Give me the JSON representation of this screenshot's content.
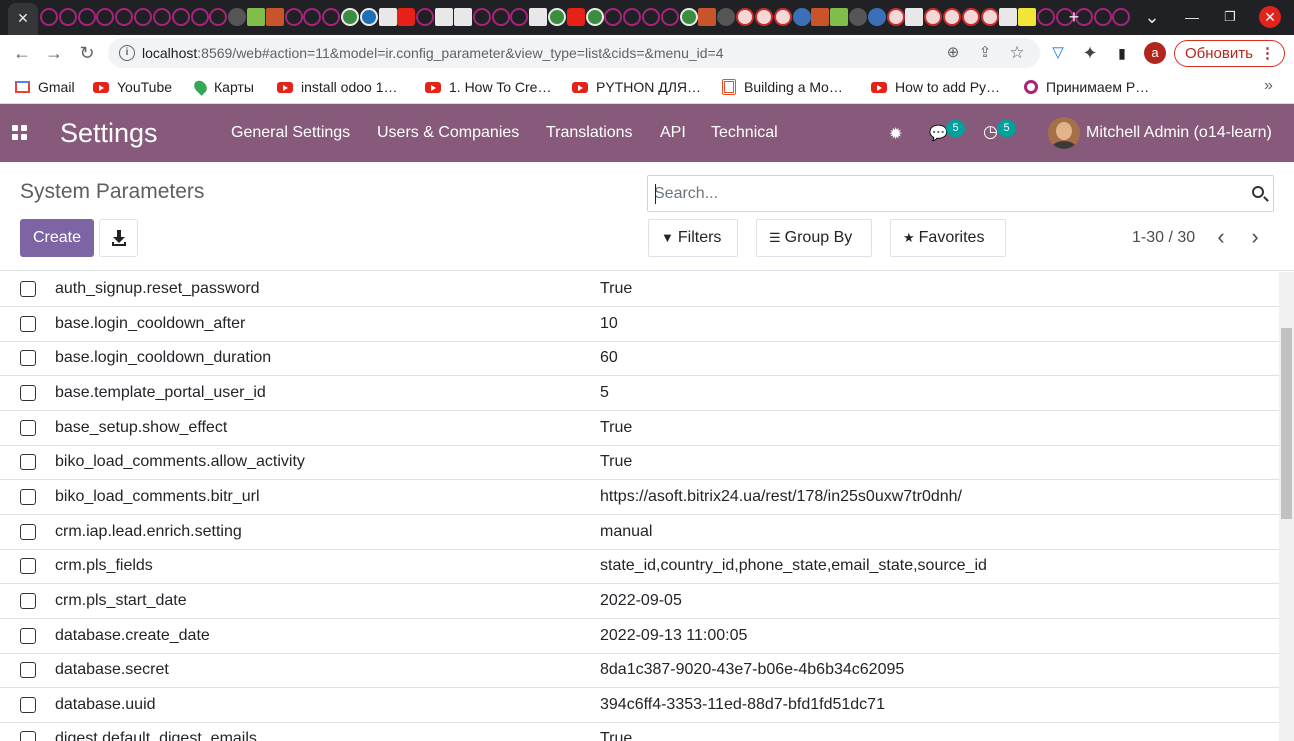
{
  "browser": {
    "tab_close": "✕",
    "new_tab": "+",
    "tab_search": "⌄",
    "min": "—",
    "restore": "❐",
    "close": "✕",
    "url_host": "localhost",
    "url_rest": ":8569/web#action=11&model=ir.config_parameter&view_type=list&cids=&menu_id=4",
    "profile_letter": "a",
    "update_label": "Обновить",
    "update_dots": "⋮",
    "icons": {
      "back": "←",
      "forward": "→",
      "reload": "↻",
      "zoom": "⊕",
      "share": "⇪",
      "star": "☆",
      "vpn": "▽",
      "ext": "✦",
      "sidepanel": "▮"
    }
  },
  "bookmarks": [
    {
      "label": "Gmail",
      "icon": "gmail"
    },
    {
      "label": "YouTube",
      "icon": "youtube"
    },
    {
      "label": "Карты",
      "icon": "maps"
    },
    {
      "label": "install odoo 1…",
      "icon": "youtube"
    },
    {
      "label": "1. How To Cre…",
      "icon": "youtube"
    },
    {
      "label": "PYTHON ДЛЯ…",
      "icon": "youtube"
    },
    {
      "label": "Building a Mo…",
      "icon": "stack"
    },
    {
      "label": "How to add Py…",
      "icon": "youtube"
    },
    {
      "label": "Принимаем Р…",
      "icon": "ring"
    }
  ],
  "bookmarks_more": "»",
  "odoo": {
    "app_title": "Settings",
    "menu": [
      "General Settings",
      "Users & Companies",
      "Translations",
      "API",
      "Technical"
    ],
    "icons": {
      "debug": "✹",
      "messages": "💬",
      "activity": "◷"
    },
    "messages_badge": "5",
    "activity_badge": "5",
    "user_name": "Mitchell Admin (o14-learn)"
  },
  "control_panel": {
    "breadcrumb": "System Parameters",
    "create_label": "Create",
    "search_placeholder": "Search...",
    "filters_label": "Filters",
    "groupby_label": "Group By",
    "favorites_label": "Favorites",
    "pager": "1-30 / 30",
    "pager_prev": "‹",
    "pager_next": "›",
    "filter_glyph": "▼",
    "groupby_glyph": "☰",
    "favorites_glyph": "★"
  },
  "rows": [
    {
      "key": "auth_signup.reset_password",
      "value": "True"
    },
    {
      "key": "base.login_cooldown_after",
      "value": "10"
    },
    {
      "key": "base.login_cooldown_duration",
      "value": "60"
    },
    {
      "key": "base.template_portal_user_id",
      "value": "5"
    },
    {
      "key": "base_setup.show_effect",
      "value": "True"
    },
    {
      "key": "biko_load_comments.allow_activity",
      "value": "True"
    },
    {
      "key": "biko_load_comments.bitr_url",
      "value": "https://asoft.bitrix24.ua/rest/178/in25s0uxw7tr0dnh/"
    },
    {
      "key": "crm.iap.lead.enrich.setting",
      "value": "manual"
    },
    {
      "key": "crm.pls_fields",
      "value": "state_id,country_id,phone_state,email_state,source_id"
    },
    {
      "key": "crm.pls_start_date",
      "value": "2022-09-05"
    },
    {
      "key": "database.create_date",
      "value": "2022-09-13 11:00:05"
    },
    {
      "key": "database.secret",
      "value": "8da1c387-9020-43e7-b06e-4b6b34c62095"
    },
    {
      "key": "database.uuid",
      "value": "394c6ff4-3353-11ed-88d7-bfd1fd51dc71"
    },
    {
      "key": "digest.default_digest_emails",
      "value": "True"
    }
  ]
}
